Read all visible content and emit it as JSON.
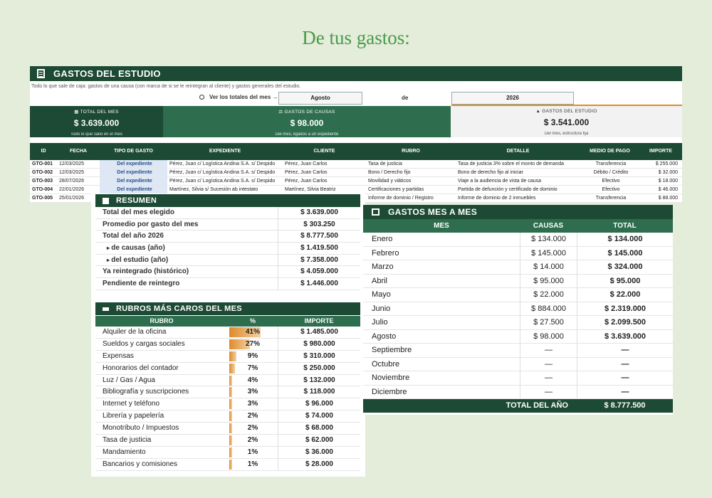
{
  "headline": "De tus gastos:",
  "sheet": {
    "title": "GASTOS DEL ESTUDIO",
    "subtitle": "Todo lo que sale de caja: gastos de una causa (con marca de si se le reintegran al cliente) y gastos generales del estudio.",
    "filter_label": "Ver los totales del mes →",
    "month": "Agosto",
    "de": "de",
    "year": "2026"
  },
  "kpis": [
    {
      "label": "TOTAL DEL MES",
      "value": "$ 3.639.000",
      "sub": "Todo lo que salió en el mes"
    },
    {
      "label": "GASTOS DE CAUSAS",
      "value": "$ 98.000",
      "sub": "Del mes, ligados a un expediente"
    },
    {
      "label": "GASTOS DEL ESTUDIO",
      "value": "$ 3.541.000",
      "sub": "Del mes, estructura fija"
    }
  ],
  "gastos_table": {
    "headers": [
      "ID",
      "FECHA",
      "TIPO DE GASTO",
      "EXPEDIENTE",
      "CLIENTE",
      "RUBRO",
      "DETALLE",
      "MEDIO DE PAGO",
      "IMPORTE"
    ],
    "rows": [
      [
        "GTO-001",
        "12/03/2025",
        "Del expediente",
        "Pérez, Juan c/ Logística Andina S.A. s/ Despido",
        "Pérez, Juan Carlos",
        "Tasa de justicia",
        "Tasa de justicia 3% sobre el monto de demanda",
        "Transferencia",
        "$ 255.000"
      ],
      [
        "GTO-002",
        "12/03/2025",
        "Del expediente",
        "Pérez, Juan c/ Logística Andina S.A. s/ Despido",
        "Pérez, Juan Carlos",
        "Bono / Derecho fijo",
        "Bono de derecho fijo al iniciar",
        "Débito / Crédito",
        "$ 32.000"
      ],
      [
        "GTO-003",
        "28/07/2026",
        "Del expediente",
        "Pérez, Juan c/ Logística Andina S.A. s/ Despido",
        "Pérez, Juan Carlos",
        "Movilidad y viáticos",
        "Viaje a la audiencia de vista de causa",
        "Efectivo",
        "$ 18.000"
      ],
      [
        "GTO-004",
        "22/01/2026",
        "Del expediente",
        "Martínez, Silvia s/ Sucesión ab intestato",
        "Martínez, Silvia Beatriz",
        "Certificaciones y partidas",
        "Partida de defunción y certificado de dominio",
        "Efectivo",
        "$ 46.000"
      ],
      [
        "GTO-005",
        "25/01/2026",
        "",
        "",
        "",
        "Informe de dominio / Registro",
        "Informe de dominio de 2 inmuebles",
        "Transferencia",
        "$ 88.000"
      ]
    ]
  },
  "resumen": {
    "title": "RESUMEN",
    "rows": [
      {
        "label": "Total del mes elegido",
        "value": "$ 3.639.000",
        "sub": false
      },
      {
        "label": "Promedio por gasto del mes",
        "value": "$ 303.250",
        "sub": false
      },
      {
        "label": "Total del año 2026",
        "value": "$ 8.777.500",
        "sub": false
      },
      {
        "label": "de causas (año)",
        "value": "$ 1.419.500",
        "sub": true
      },
      {
        "label": "del estudio (año)",
        "value": "$ 7.358.000",
        "sub": true
      },
      {
        "label": "Ya reintegrado (histórico)",
        "value": "$ 4.059.000",
        "sub": false
      },
      {
        "label": "Pendiente de reintegro",
        "value": "$ 1.446.000",
        "sub": false
      }
    ]
  },
  "rubros": {
    "title": "RUBROS MÁS CAROS DEL MES",
    "headers": [
      "RUBRO",
      "%",
      "IMPORTE"
    ],
    "rows": [
      {
        "label": "Alquiler de la oficina",
        "pct": "41%",
        "frac": 0.41,
        "value": "$ 1.485.000"
      },
      {
        "label": "Sueldos y cargas sociales",
        "pct": "27%",
        "frac": 0.27,
        "value": "$ 980.000"
      },
      {
        "label": "Expensas",
        "pct": "9%",
        "frac": 0.09,
        "value": "$ 310.000"
      },
      {
        "label": "Honorarios del contador",
        "pct": "7%",
        "frac": 0.07,
        "value": "$ 250.000"
      },
      {
        "label": "Luz / Gas / Agua",
        "pct": "4%",
        "frac": 0.04,
        "value": "$ 132.000"
      },
      {
        "label": "Bibliografía y suscripciones",
        "pct": "3%",
        "frac": 0.03,
        "value": "$ 118.000"
      },
      {
        "label": "Internet y teléfono",
        "pct": "3%",
        "frac": 0.03,
        "value": "$ 96.000"
      },
      {
        "label": "Librería y papelería",
        "pct": "2%",
        "frac": 0.02,
        "value": "$ 74.000"
      },
      {
        "label": "Monotributo / Impuestos",
        "pct": "2%",
        "frac": 0.02,
        "value": "$ 68.000"
      },
      {
        "label": "Tasa de justicia",
        "pct": "2%",
        "frac": 0.02,
        "value": "$ 62.000"
      },
      {
        "label": "Mandamiento",
        "pct": "1%",
        "frac": 0.01,
        "value": "$ 36.000"
      },
      {
        "label": "Bancarios y comisiones",
        "pct": "1%",
        "frac": 0.01,
        "value": "$ 28.000"
      }
    ]
  },
  "mes_a_mes": {
    "title": "GASTOS MES A MES",
    "headers": [
      "MES",
      "CAUSAS",
      "TOTAL"
    ],
    "rows": [
      {
        "mes": "Enero",
        "causas": "$ 134.000",
        "total": "$ 134.000"
      },
      {
        "mes": "Febrero",
        "causas": "$ 145.000",
        "total": "$ 145.000"
      },
      {
        "mes": "Marzo",
        "causas": "$ 14.000",
        "total": "$ 324.000"
      },
      {
        "mes": "Abril",
        "causas": "$ 95.000",
        "total": "$ 95.000"
      },
      {
        "mes": "Mayo",
        "causas": "$ 22.000",
        "total": "$ 22.000"
      },
      {
        "mes": "Junio",
        "causas": "$ 884.000",
        "total": "$ 2.319.000"
      },
      {
        "mes": "Julio",
        "causas": "$ 27.500",
        "total": "$ 2.099.500"
      },
      {
        "mes": "Agosto",
        "causas": "$ 98.000",
        "total": "$ 3.639.000"
      },
      {
        "mes": "Septiembre",
        "causas": "—",
        "total": "—"
      },
      {
        "mes": "Octubre",
        "causas": "—",
        "total": "—"
      },
      {
        "mes": "Noviembre",
        "causas": "—",
        "total": "—"
      },
      {
        "mes": "Diciembre",
        "causas": "—",
        "total": "—"
      }
    ],
    "footer_label": "TOTAL DEL AÑO",
    "footer_value": "$ 8.777.500"
  },
  "colors": {
    "dark_green": "#1d4a34",
    "mid_green": "#2e6e4e",
    "accent_orange": "#e08a2a",
    "background": "#e4ecda"
  }
}
